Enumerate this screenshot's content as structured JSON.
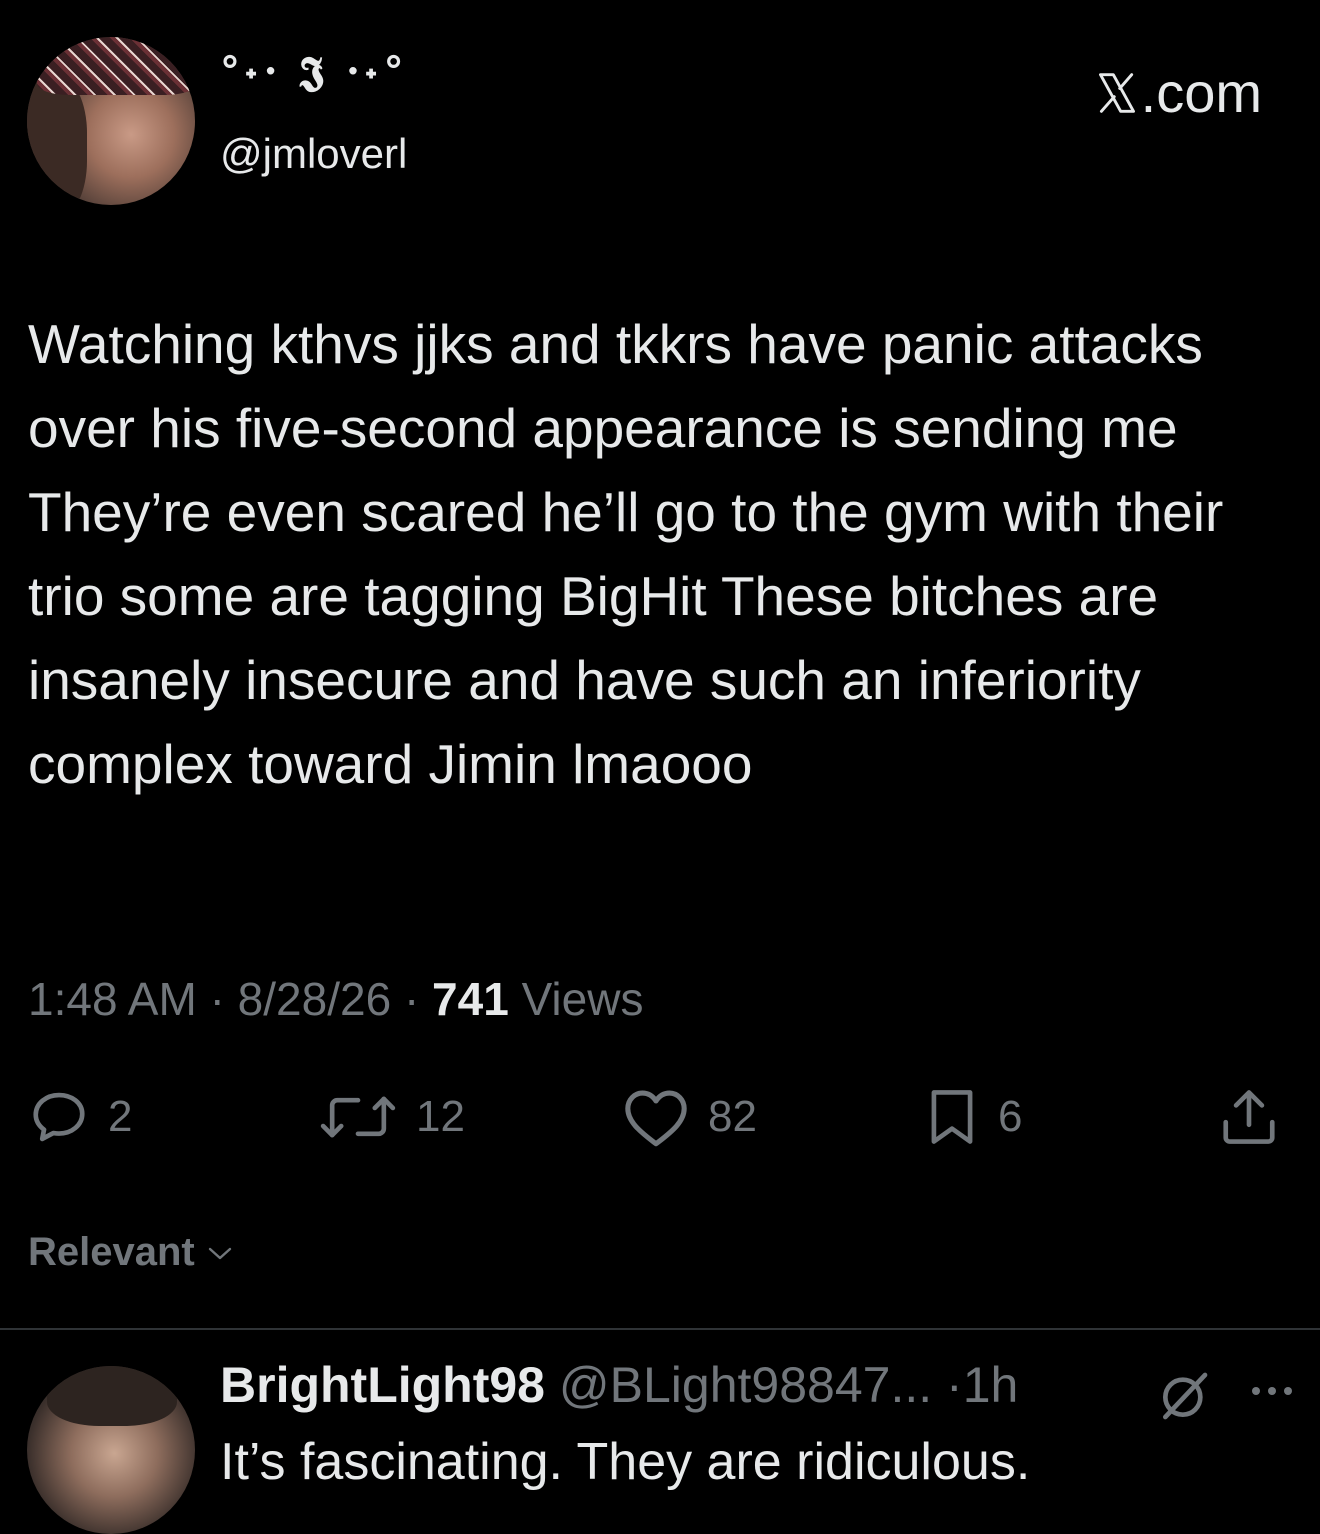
{
  "tweet": {
    "display_name": "°˖· 𝕵 ·˖°",
    "handle": "@jmloverl",
    "brand": ".com",
    "text": "Watching kthvs jjks and tkkrs have panic attacks over his five-second appearance is sending me They’re even scared he’ll go to the gym with their trio some are tagging BigHit These bitches are insanely insecure and have such an inferiority complex toward Jimin lmaooo",
    "time": "1:48 AM",
    "date": "8/28/26",
    "separator": "·",
    "views_count": "741",
    "views_label": "Views"
  },
  "actions": {
    "replies": "2",
    "reposts": "12",
    "likes": "82",
    "bookmarks": "6"
  },
  "sort": {
    "label": "Relevant"
  },
  "reply": {
    "name": "BrightLight98",
    "handle": "@BLight98847...",
    "separator": "·",
    "time": "1h",
    "text": "It’s fascinating. They are ridiculous."
  },
  "icons": {
    "reply": "reply-icon",
    "repost": "repost-icon",
    "like": "heart-icon",
    "bookmark": "bookmark-icon",
    "share": "share-icon",
    "chevron": "chevron-down-icon",
    "grok": "grok-icon",
    "more": "more-icon",
    "x_logo": "x-logo-icon"
  },
  "colors": {
    "background": "#000000",
    "text_primary": "#e7e9ea",
    "text_secondary": "#71767b",
    "divider": "#2f3336"
  }
}
